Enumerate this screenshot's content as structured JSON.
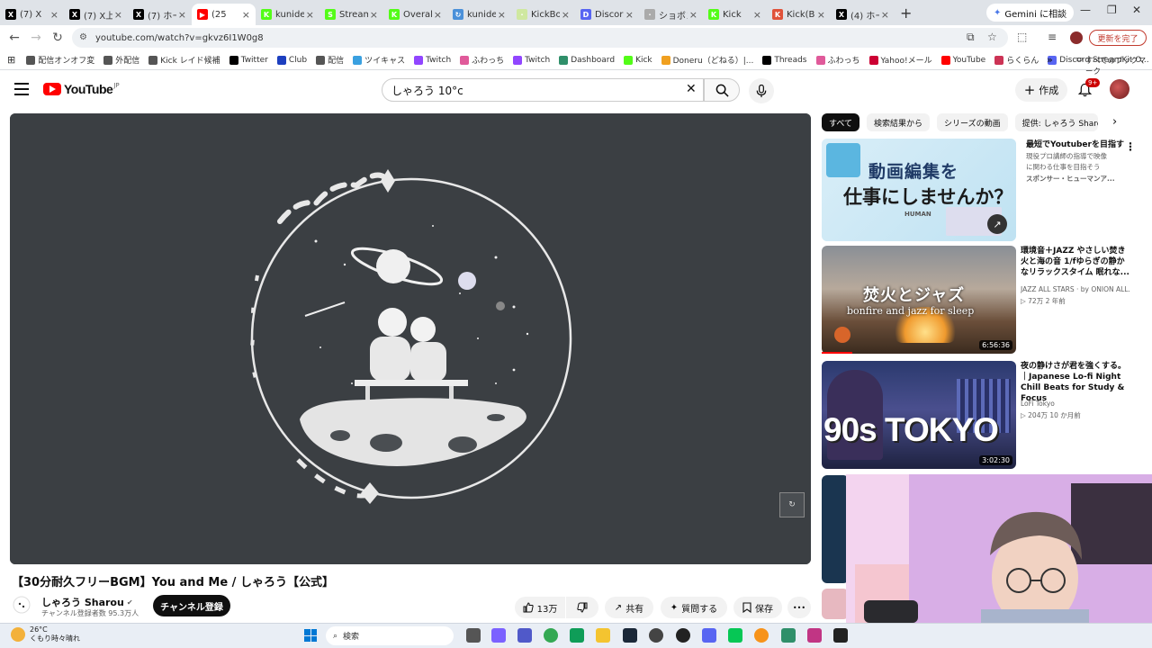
{
  "browser": {
    "tabs": [
      {
        "label": "(7) X",
        "color": "#000000",
        "glyph": "X"
      },
      {
        "label": "(7) X上",
        "color": "#000000",
        "glyph": "X"
      },
      {
        "label": "(7) ホー",
        "color": "#000000",
        "glyph": "X"
      },
      {
        "label": "(25",
        "color": "#ff0000",
        "glyph": "▶",
        "active": true
      },
      {
        "label": "kunide",
        "color": "#53fc18",
        "glyph": "K"
      },
      {
        "label": "Stream",
        "color": "#53fc18",
        "glyph": "S"
      },
      {
        "label": "Overal",
        "color": "#53fc18",
        "glyph": "K"
      },
      {
        "label": "kunide",
        "color": "#4a90d9",
        "glyph": "↻"
      },
      {
        "label": "KickBo",
        "color": "#cfe8a0",
        "glyph": "·"
      },
      {
        "label": "Discor",
        "color": "#5865f2",
        "glyph": "D"
      },
      {
        "label": "ショボン",
        "color": "#aaaaaa",
        "glyph": "·"
      },
      {
        "label": "Kick",
        "color": "#53fc18",
        "glyph": "K"
      },
      {
        "label": "Kick(B",
        "color": "#e0523a",
        "glyph": "K"
      },
      {
        "label": "(4) ホー",
        "color": "#000000",
        "glyph": "X"
      }
    ],
    "new_tab": "+",
    "gemini": "Gemini に相談",
    "url": "youtube.com/watch?v=gkvz6I1W0g8",
    "update_button": "更新を完了",
    "bookmarks": [
      {
        "label": "配信オンオフ変",
        "color": "#555555"
      },
      {
        "label": "外配信",
        "color": "#555555"
      },
      {
        "label": "Kick レイド候補",
        "color": "#555555"
      },
      {
        "label": "Twitter",
        "color": "#000000"
      },
      {
        "label": "Club",
        "color": "#1d3fbf"
      },
      {
        "label": "配信",
        "color": "#555555"
      },
      {
        "label": "ツイキャス",
        "color": "#3aa0e0"
      },
      {
        "label": "Twitch",
        "color": "#9146ff"
      },
      {
        "label": "ふわっち",
        "color": "#e05a9a"
      },
      {
        "label": "Twitch",
        "color": "#9146ff"
      },
      {
        "label": "Dashboard",
        "color": "#2f8f6a"
      },
      {
        "label": "Kick",
        "color": "#53fc18"
      },
      {
        "label": "Doneru（どねる）|...",
        "color": "#f0a020"
      },
      {
        "label": "Threads",
        "color": "#000000"
      },
      {
        "label": "ふわっち",
        "color": "#e05a9a"
      },
      {
        "label": "Yahoo!メール",
        "color": "#cc0033"
      },
      {
        "label": "YouTube",
        "color": "#ff0000"
      },
      {
        "label": "らくらん",
        "color": "#cc3355"
      },
      {
        "label": "Discord StreamKit O...",
        "color": "#5865f2"
      }
    ],
    "bookmarks_more": "»",
    "all_bookmarks": "すべてのブックマーク"
  },
  "youtube": {
    "logo_text": "YouTube",
    "logo_region": "JP",
    "search_query": "しゃろう 10°c",
    "create_label": "作成",
    "notifications_badge": "9+",
    "video": {
      "title": "【30分耐久フリーBGM】You and Me / しゃろう【公式】",
      "channel_name": "しゃろう Sharou",
      "subscribers": "チャンネル登録者数 95.3万人",
      "subscribe_label": "チャンネル登録",
      "likes": "13万",
      "share_label": "共有",
      "ask_label": "質問する",
      "save_label": "保存",
      "more_label": "•••"
    },
    "chips": [
      "すべて",
      "検索結果から",
      "シリーズの動画",
      "提供: しゃろう Sharou"
    ],
    "recommendations": [
      {
        "thumb_top": "動画編集を",
        "thumb_bottom": "仕事にしませんか？",
        "thumb_brand": "HUMAN",
        "title": "最短でYoutuberを目指す",
        "meta1": "現役プロ講師の指導で映像",
        "meta2": "に関わる仕事を目指そう",
        "meta3": "スポンサー・ヒューマンア..."
      },
      {
        "thumb_jp": "焚火とジャズ",
        "thumb_en": "bonfire and jazz for sleep",
        "duration": "6:56:36",
        "title": "環境音＋JAZZ やさしい焚き火と海の音 1/fゆらぎの静かなリラックスタイム 眠れな...",
        "meta1": "JAZZ ALL STARS · by ONION ALL...",
        "meta2": "▷ 72万 2 年前"
      },
      {
        "thumb_text": "90s TOKYO",
        "duration": "3:02:30",
        "title": "夜の静けさが君を強くする。｜Japanese Lo-fi Night Chill Beats for Study & Focus",
        "meta1": "LoFi Tokyo",
        "meta2": "▷ 204万 10 か月前"
      }
    ]
  },
  "taskbar": {
    "temperature": "26°C",
    "weather_text": "くもり時々晴れ",
    "search_label": "検索"
  },
  "icons": {
    "back": "←",
    "forward": "→",
    "reload": "↻",
    "search": "⌕",
    "mic": "🎤",
    "bell": "🔔",
    "like": "👍",
    "dislike": "👎",
    "share": "↗",
    "sparkle": "✦",
    "bookmark": "🔖",
    "close": "✕"
  }
}
